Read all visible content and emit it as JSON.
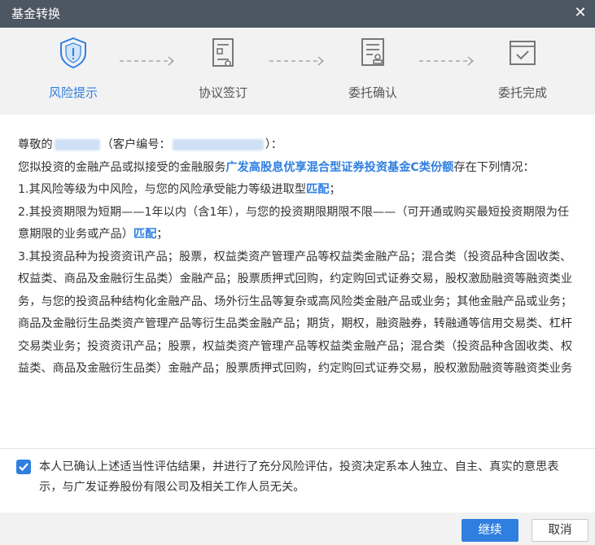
{
  "window": {
    "title": "基金转换",
    "close_glyph": "✕"
  },
  "steps": [
    {
      "label": "风险提示",
      "icon": "shield-icon",
      "active": true
    },
    {
      "label": "协议签订",
      "icon": "contract-icon",
      "active": false
    },
    {
      "label": "委托确认",
      "icon": "document-stamp-icon",
      "active": false
    },
    {
      "label": "委托完成",
      "icon": "check-window-icon",
      "active": false
    }
  ],
  "colors": {
    "accent": "#2f7fe0",
    "titlebar": "#4d5663",
    "panel": "#f2f2f2",
    "inactive_icon": "#777777"
  },
  "content": {
    "greeting_prefix": "尊敬的",
    "client_no_prefix": "（客户编号：",
    "client_no_suffix": "）：",
    "intro_prefix": "您拟投资的金融产品或拟接受的金融服务",
    "product_name": "广发高股息优享混合型证券投资基金C类份额",
    "intro_suffix": "存在下列情况：",
    "item1_text": "1.其风险等级为中风险，与您的风险承受能力等级进取型",
    "item1_match": "匹配",
    "item1_end": "；",
    "item2_text": "2.其投资期限为短期——1年以内（含1年），与您的投资期限期限不限——（可开通或购买最短投资期限为任意期限的业务或产品）",
    "item2_match": "匹配",
    "item2_end": "；",
    "item3_text": "3.其投资品种为投资资讯产品；股票，权益类资产管理产品等权益类金融产品；混合类（投资品种含固收类、权益类、商品及金融衍生品类）金融产品；股票质押式回购，约定购回式证券交易，股权激励融资等融资类业务，与您的投资品种结构化金融产品、场外衍生品等复杂或高风险类金融产品或业务；其他金融产品或业务；商品及金融衍生品类资产管理产品等衍生品类金融产品；期货，期权，融资融券，转融通等信用交易类、杠杆交易类业务；投资资讯产品；股票，权益类资产管理产品等权益类金融产品；混合类（投资品种含固收类、权益类、商品及金融衍生品类）金融产品；股票质押式回购，约定购回式证券交易，股权激励融资等融资类业务"
  },
  "confirm": {
    "checked": true,
    "text": "本人已确认上述适当性评估结果，并进行了充分风险评估，投资决定系本人独立、自主、真实的意思表示，与广发证券股份有限公司及相关工作人员无关。"
  },
  "buttons": {
    "continue": "继续",
    "cancel": "取消"
  }
}
